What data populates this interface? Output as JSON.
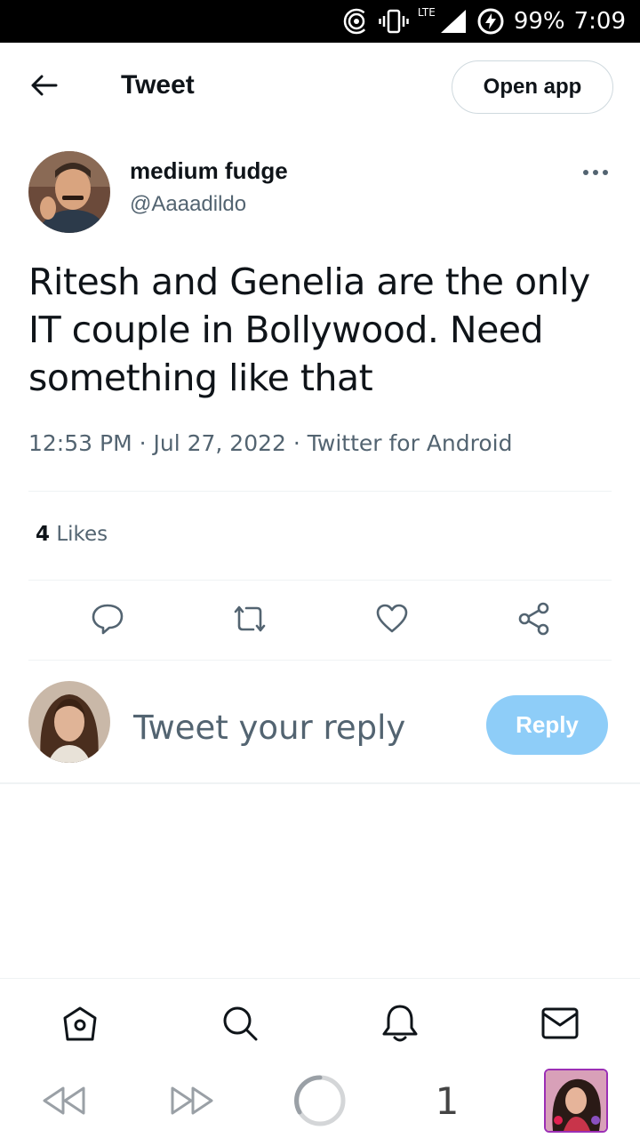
{
  "status_bar": {
    "battery": "99%",
    "time": "7:09",
    "network": "LTE"
  },
  "header": {
    "title": "Tweet",
    "open_app_label": "Open app"
  },
  "tweet": {
    "author_name": "medium fudge",
    "author_handle": "@Aaaadildo",
    "text": "Ritesh and Genelia are the only IT couple in Bollywood. Need something like that",
    "meta": "12:53 PM · Jul 27, 2022 · Twitter for Android",
    "likes_count": "4",
    "likes_label": "Likes"
  },
  "reply": {
    "placeholder": "Tweet your reply",
    "button_label": "Reply"
  },
  "browser": {
    "tab_count": "1"
  },
  "colors": {
    "accent_light": "#8ecdf8",
    "muted": "#536471",
    "text": "#0f1419"
  }
}
